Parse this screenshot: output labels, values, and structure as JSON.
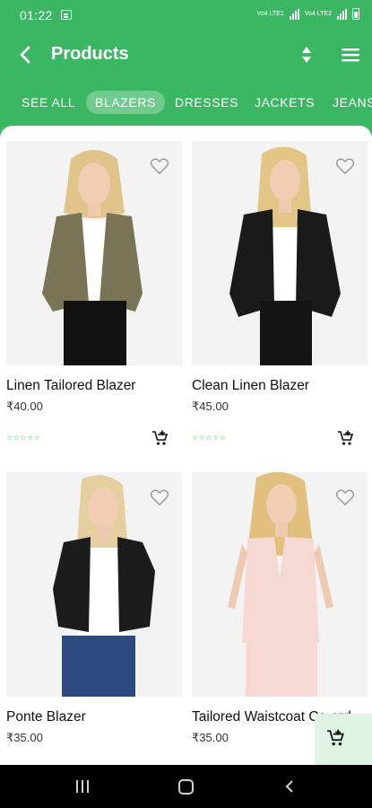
{
  "status_bar": {
    "time": "01:22",
    "volte": "Vo4 LTE1",
    "volte2": "Vo4 LTE2"
  },
  "header": {
    "title": "Products"
  },
  "tabs": [
    {
      "label": "SEE ALL",
      "active": false
    },
    {
      "label": "BLAZERS",
      "active": true
    },
    {
      "label": "DRESSES",
      "active": false
    },
    {
      "label": "JACKETS",
      "active": false
    },
    {
      "label": "JEANS",
      "active": false
    }
  ],
  "products": [
    {
      "name": "Linen Tailored Blazer",
      "price": "₹40.00",
      "rating": "☆☆☆☆☆",
      "jacket_color": "#7a7456"
    },
    {
      "name": "Clean Linen Blazer",
      "price": "₹45.00",
      "rating": "☆☆☆☆☆",
      "jacket_color": "#1a1a1a"
    },
    {
      "name": "Ponte Blazer",
      "price": "₹35.00",
      "rating": "",
      "jacket_color": "#1c1c1c"
    },
    {
      "name": "Tailored Waistcoat Co-ord",
      "price": "₹35.00",
      "rating": "",
      "jacket_color": "#f6d9d3"
    }
  ],
  "colors": {
    "brand": "#3bb764",
    "fab_bg": "#dff3e4"
  }
}
